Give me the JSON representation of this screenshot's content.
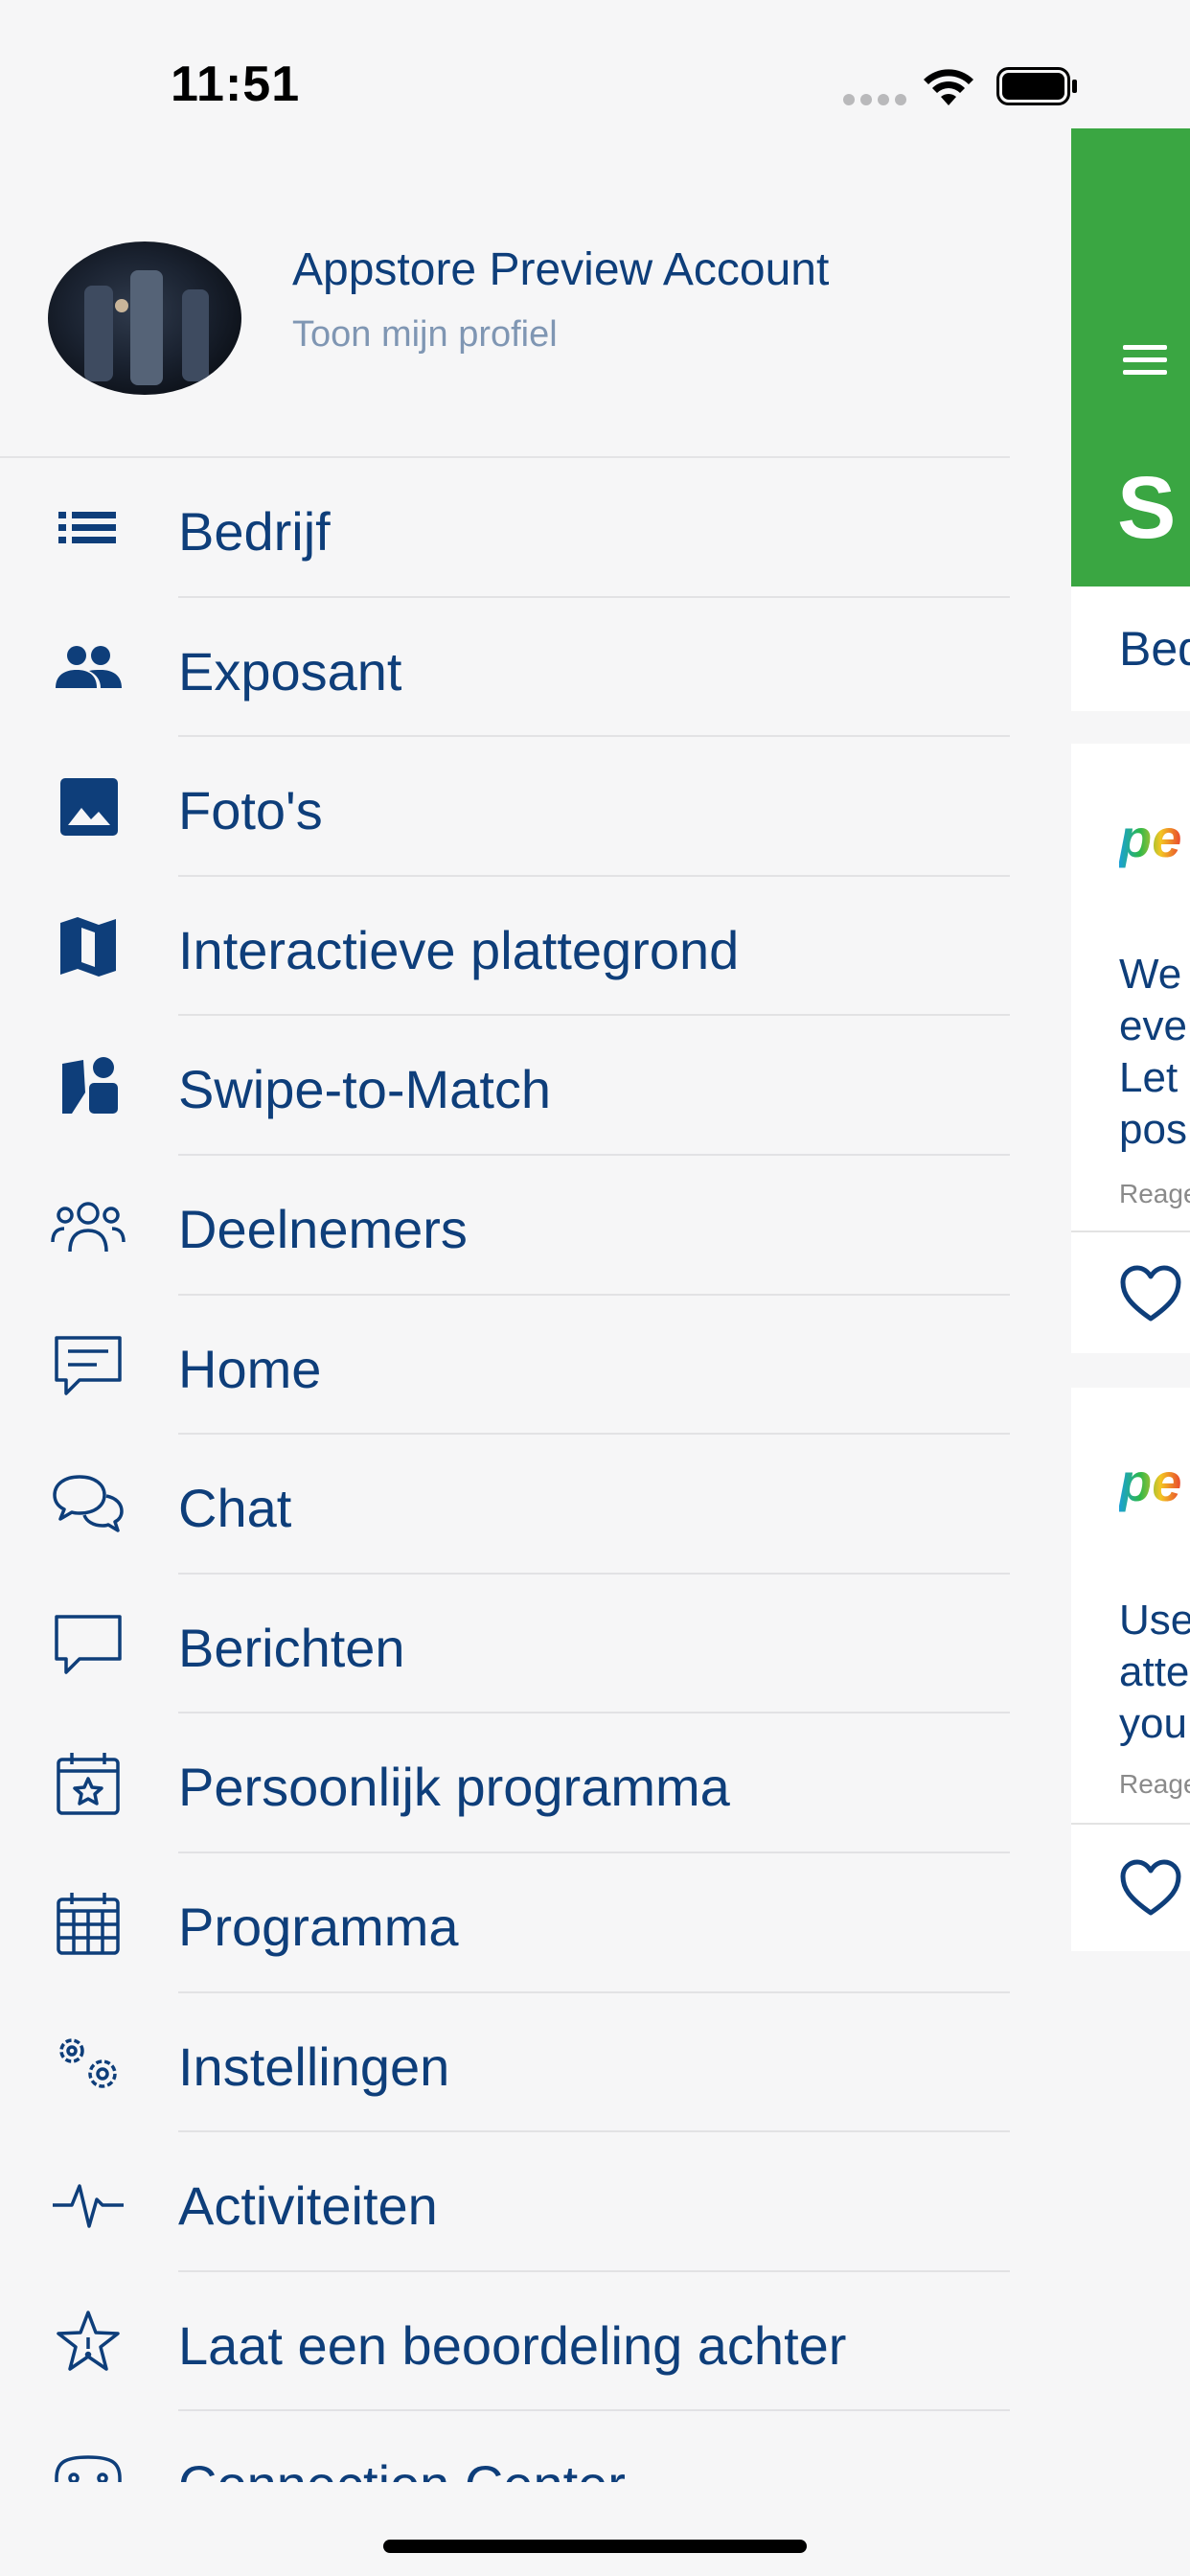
{
  "status_bar": {
    "time": "11:51"
  },
  "profile": {
    "name": "Appstore Preview Account",
    "link_label": "Toon mijn profiel"
  },
  "menu": {
    "items": [
      {
        "label": "Bedrijf",
        "icon": "list-icon"
      },
      {
        "label": "Exposant",
        "icon": "people-icon"
      },
      {
        "label": "Foto's",
        "icon": "image-icon"
      },
      {
        "label": "Interactieve plattegrond",
        "icon": "map-icon"
      },
      {
        "label": "Swipe-to-Match",
        "icon": "swipe-cards-icon"
      },
      {
        "label": "Deelnemers",
        "icon": "participants-icon"
      },
      {
        "label": "Home",
        "icon": "message-square-icon"
      },
      {
        "label": "Chat",
        "icon": "chat-bubbles-icon"
      },
      {
        "label": "Berichten",
        "icon": "speech-bubble-icon"
      },
      {
        "label": "Persoonlijk programma",
        "icon": "calendar-star-icon"
      },
      {
        "label": "Programma",
        "icon": "calendar-grid-icon"
      },
      {
        "label": "Instellingen",
        "icon": "gears-icon"
      },
      {
        "label": "Activiteiten",
        "icon": "activity-pulse-icon"
      },
      {
        "label": "Laat een beoordeling achter",
        "icon": "star-icon"
      },
      {
        "label": "Connection Center",
        "icon": "connection-icon"
      }
    ]
  },
  "background_app": {
    "header_title": "S",
    "tab_label": "Bed",
    "posts": [
      {
        "logo_text": "pe",
        "lines": [
          "We",
          "even",
          "Let",
          "pos"
        ],
        "meta": "Reage"
      },
      {
        "logo_text": "pe",
        "lines": [
          "Use",
          "atte",
          "you"
        ],
        "meta": "Reage"
      }
    ]
  },
  "colors": {
    "text_primary": "#0e3e7a",
    "text_secondary": "#7f96b3",
    "header_green": "#3aa642",
    "drawer_background": "#f6f6f7"
  }
}
